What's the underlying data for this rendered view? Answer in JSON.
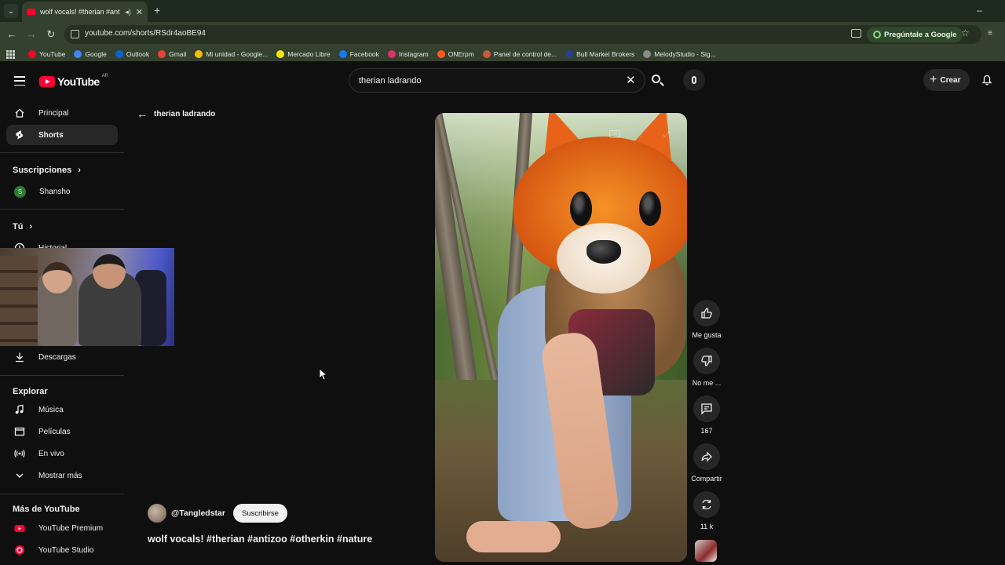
{
  "browser": {
    "tab_title": "wolf vocals! #therian #antiz",
    "url": "youtube.com/shorts/RSdr4aoBE94",
    "ask_google_label": "Pregúntale a Google",
    "bookmarks": [
      {
        "label": "YouTube",
        "color": "#ff0033"
      },
      {
        "label": "Google",
        "color": "#4285f4"
      },
      {
        "label": "Outlook",
        "color": "#0a64c9"
      },
      {
        "label": "Gmail",
        "color": "#ea4335"
      },
      {
        "label": "Mi unidad - Google...",
        "color": "#fbbc04"
      },
      {
        "label": "Mercado Libre",
        "color": "#ffe600"
      },
      {
        "label": "Facebook",
        "color": "#1877f2"
      },
      {
        "label": "Instagram",
        "color": "#e1306c"
      },
      {
        "label": "ONErpm",
        "color": "#ff5a1f"
      },
      {
        "label": "Panel de control de...",
        "color": "#c85a3a"
      },
      {
        "label": "Bull Market Brokers",
        "color": "#2d3b8c"
      },
      {
        "label": "MelodyStudio - Sig...",
        "color": "#8a8a8a"
      }
    ]
  },
  "header": {
    "logo_text": "YouTube",
    "country_code": "AR",
    "search_value": "therian ladrando",
    "create_label": "Crear"
  },
  "sidebar": {
    "main_items": [
      {
        "label": "Principal",
        "icon": "home-icon"
      },
      {
        "label": "Shorts",
        "icon": "shorts-icon",
        "active": true
      }
    ],
    "subscriptions_title": "Suscripciones",
    "subscriptions": [
      {
        "label": "Shansho",
        "initial": "S"
      }
    ],
    "you_title": "Tú",
    "history_label": "Historial",
    "downloads_label": "Descargas",
    "explore_title": "Explorar",
    "explore_items": [
      {
        "label": "Música",
        "icon": "music-icon"
      },
      {
        "label": "Películas",
        "icon": "movies-icon"
      },
      {
        "label": "En vivo",
        "icon": "live-icon"
      },
      {
        "label": "Mostrar más",
        "icon": "chevron-down-icon"
      }
    ],
    "more_title": "Más de YouTube",
    "more_items": [
      {
        "label": "YouTube Premium",
        "icon": "youtube-premium-icon"
      },
      {
        "label": "YouTube Studio",
        "icon": "youtube-studio-icon"
      }
    ]
  },
  "main": {
    "query_label": "therian ladrando",
    "channel_handle": "@Tangledstar",
    "subscribe_label": "Suscribirse",
    "short_title": "wolf vocals! #therian #antizoo #otherkin #nature",
    "actions": {
      "like_label": "Me gusta",
      "dislike_label": "No me ...",
      "comments_count": "167",
      "share_label": "Compartir",
      "remix_count": "11 k"
    }
  },
  "colors": {
    "background": "#0f0f0f",
    "brand_red": "#ff0033",
    "chrome_green": "#35412f"
  }
}
